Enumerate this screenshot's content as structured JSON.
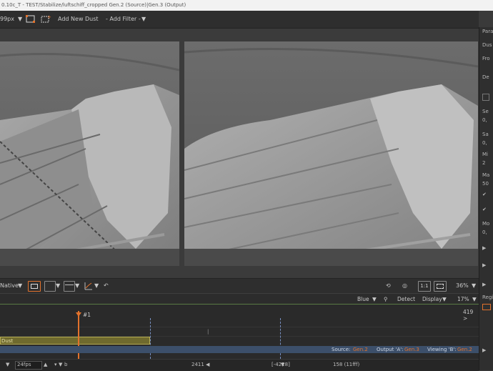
{
  "window": {
    "title": "0.10c_T - TEST/Stabilize/luftschiff_cropped Gen.2 (Source)|Gen.3 (Output)"
  },
  "toolbar": {
    "size_value": "99px",
    "add_new_dust": "Add New Dust",
    "add_filter": "- Add Filter -"
  },
  "panel": {
    "labels": [
      "Para",
      "Dus",
      "Fro",
      "De",
      "Se",
      "0,",
      "Sa",
      "0,",
      "Mi",
      "2",
      "Ma",
      "50"
    ],
    "extra_labels": [
      "Mo",
      "0,",
      "Regi"
    ]
  },
  "viewerbar": {
    "mode": "Native",
    "ratio_label": "1:1",
    "zoom": "36%"
  },
  "timeline_header": {
    "channel": "Blue",
    "detect": "Detect",
    "display": "Display",
    "percent": "17%"
  },
  "timeline": {
    "marker_label": "#1",
    "frame_count": "419 >",
    "track_label": "Dust"
  },
  "statusbar": {
    "source_label": "Source:",
    "source_value": "Gen.2",
    "output_label": "Output 'A':",
    "output_value": "Gen.3",
    "viewing_label": "Viewing 'B':",
    "viewing_value": "Gen.2"
  },
  "bottombar": {
    "fps": "24fps",
    "marker_b": "b",
    "timecode_1": "2411",
    "timecode_2": "[-4228]",
    "timecode_3": "158 (11fff)"
  },
  "colors": {
    "accent": "#e2722c",
    "status_bar": "#3c4f6a",
    "track_dust": "#6f6a2e"
  }
}
